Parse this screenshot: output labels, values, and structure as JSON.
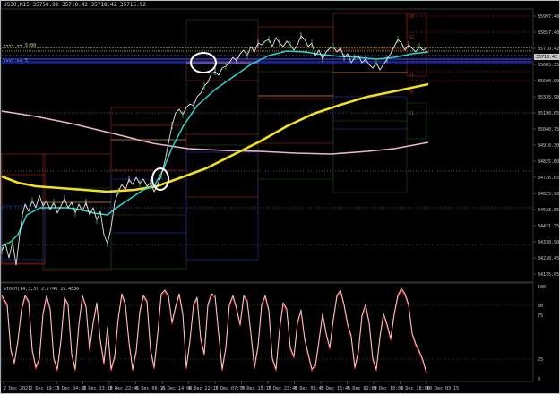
{
  "chart_title": "US30,M15  35750.92 35710.42 35718.42 35715.92",
  "indicator_label": "Stoch(14,3,3) 2.7746 19.4836",
  "price_ticks": [
    "35997.40",
    "35857.40",
    "35710.42",
    "35605.35",
    "35500.00",
    "35335.90",
    "35190.65",
    "35040.75",
    "34910.30",
    "34825.60",
    "34726.65",
    "34625.90",
    "34523.65",
    "34421.25",
    "34338.90",
    "34238.45",
    "34135.05"
  ],
  "stoch_ticks": [
    "100",
    "80",
    "75",
    "25",
    "0"
  ],
  "time_ticks": [
    "2 Dec 2021",
    "2 Dec 19:15",
    "3 Dec 04:30",
    "3 Dec 13:30",
    "3 Dec 22:45",
    "6 Dec 06:15",
    "6 Dec 14:00",
    "6 Dec 22:15",
    "7 Dec 07:30",
    "7 Dec 15:15",
    "7 Dec 23:45",
    "8 Dec 08:45",
    "8 Dec 16:45",
    "9 Dec 02:00",
    "9 Dec 10:00",
    "9 Dec 18:00",
    "10 Dec 03:15"
  ],
  "level_labels": [
    "R2",
    "R1",
    "PP",
    "S1",
    "S2",
    "R3"
  ],
  "colors": {
    "price": "#e6e6e6",
    "ma_fast": "#2fd3d0",
    "ma_mid": "#f4e01e",
    "ma_slow": "#e8b8d0",
    "stoch_main": "#e0e0e0",
    "stoch_signal": "#e0201b"
  }
}
